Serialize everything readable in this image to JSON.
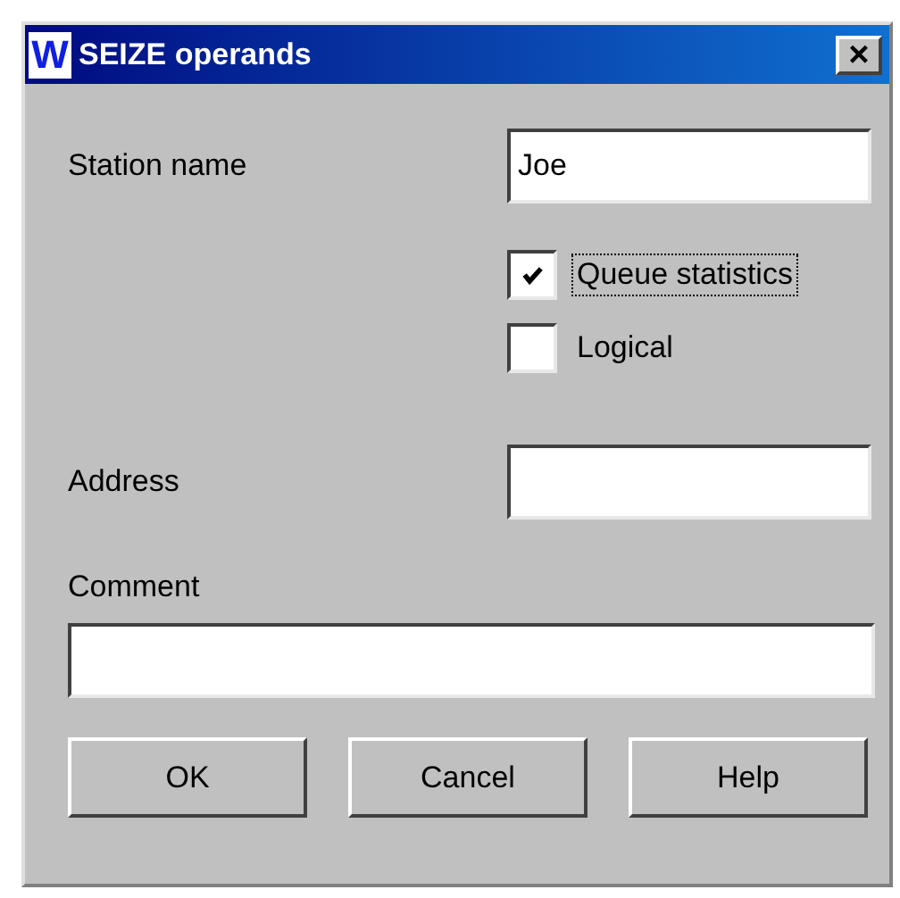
{
  "window": {
    "title": "SEIZE operands",
    "icon_letter": "W",
    "close": "×"
  },
  "station_name": {
    "label": "Station name",
    "value": "Joe"
  },
  "options": [
    {
      "label": "Queue statistics",
      "checked": true,
      "focused": true
    },
    {
      "label": "Logical",
      "checked": false,
      "focused": false
    }
  ],
  "address": {
    "label": "Address"
  },
  "comment": {
    "label": "Comment"
  },
  "buttons": [
    "OK",
    "Cancel",
    "Help"
  ]
}
